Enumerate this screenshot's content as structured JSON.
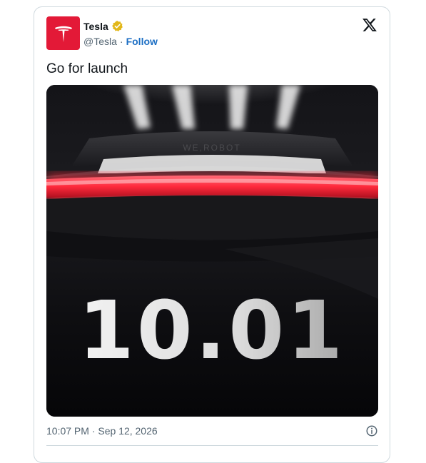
{
  "tweet": {
    "display_name": "Tesla",
    "handle": "@Tesla",
    "separator": "·",
    "follow_label": "Follow",
    "text": "Go for launch",
    "timestamp": "10:07 PM · Sep 12, 2026"
  },
  "media": {
    "date_text": "10.01",
    "tagline_text": "WE,ROBOT",
    "accent_color": "#ff2a3c",
    "avatar_color": "#e31937"
  },
  "icons": {
    "avatar": "tesla-logo-icon",
    "verified": "verified-badge-icon",
    "platform": "x-logo-icon",
    "info": "info-icon"
  }
}
